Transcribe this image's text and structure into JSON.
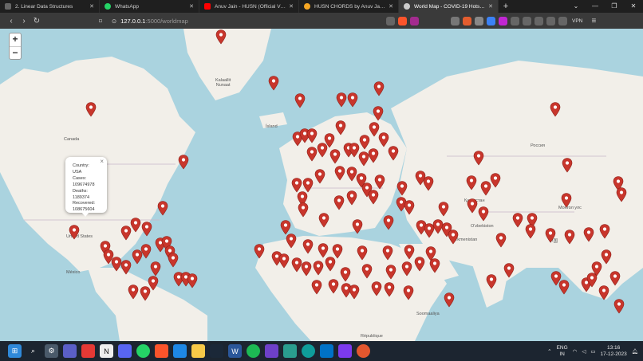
{
  "tabs": [
    {
      "label": "2. Linear Data Structures",
      "color": "#555555",
      "active": false
    },
    {
      "label": "WhatsApp",
      "color": "#25d366",
      "active": false
    },
    {
      "label": "Anuv Jain - HUSN (Official Video) - Yo",
      "color": "#ff0000",
      "active": false
    },
    {
      "label": "HUSN CHORDS by Anuv Jain @ Ultim",
      "color": "#f5a623",
      "active": false
    },
    {
      "label": "World Map - COVID-19 Hotspots",
      "color": "#dddddd",
      "active": true
    }
  ],
  "address": {
    "host": "127.0.0.1",
    "path": ":5000/worldmap"
  },
  "toolbar": {
    "vpn_label": "VPN"
  },
  "map": {
    "zoom_in": "+",
    "zoom_out": "−",
    "labels": {
      "greenland": "Kalaallit\nNunaat",
      "canada": "Canada",
      "iceland": "Ísland",
      "usa": "United States",
      "russia": "Россия",
      "kazakhstan": "Қазақстан",
      "uzbekistan": "O'zbekiston",
      "turkmenistan": "Türkmenistan",
      "mongolia": "Монгол улс",
      "china": "中国",
      "somalia": "Soomaaliya",
      "republique": "République",
      "mexico": "México"
    },
    "popup": {
      "country_label": "Country:",
      "country_value": "USA",
      "cases_label": "Cases:",
      "cases_value": "109674978",
      "deaths_label": "Deaths:",
      "deaths_value": "1189374",
      "recovered_label": "Recovered:",
      "recovered_value": "108675604",
      "close": "×"
    },
    "marker_color": "#c8362c"
  },
  "taskbar": {
    "lang_line1": "ENG",
    "lang_line2": "IN",
    "time": "13:16",
    "date": "17-12-2023"
  }
}
